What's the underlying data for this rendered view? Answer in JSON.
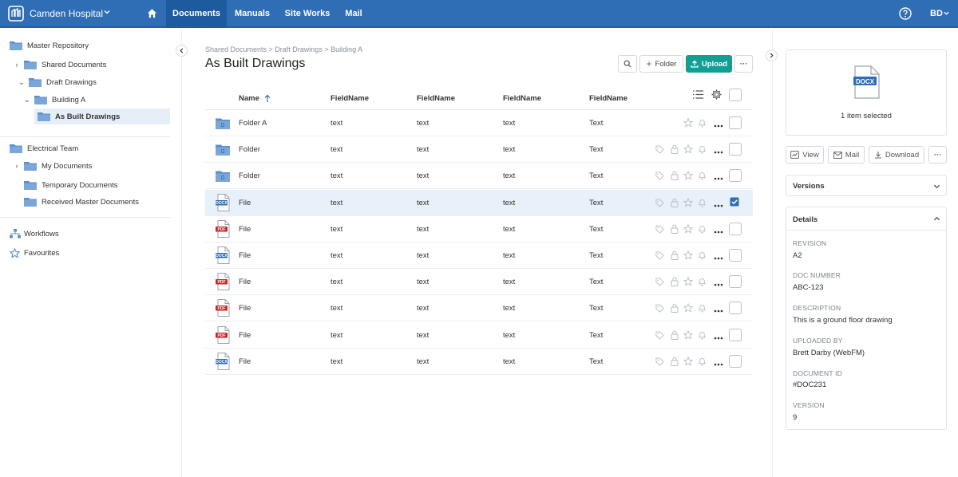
{
  "app": {
    "name": "Camden Hospital",
    "user_initials": "BD"
  },
  "nav": {
    "tabs": [
      {
        "label": "Documents"
      },
      {
        "label": "Manuals"
      },
      {
        "label": "Site Works"
      },
      {
        "label": "Mail"
      }
    ]
  },
  "tree": {
    "items": [
      {
        "label": "Master Repository"
      },
      {
        "label": "Shared Documents"
      },
      {
        "label": "Draft Drawings"
      },
      {
        "label": "Building A"
      },
      {
        "label": "As Built Drawings"
      },
      {
        "label": "Electrical Team"
      },
      {
        "label": "My Documents"
      },
      {
        "label": "Temporary Documents"
      },
      {
        "label": "Received Master Documents"
      }
    ],
    "workflows": "Workflows",
    "favourites": "Favourites"
  },
  "breadcrumb": "Shared Documents > Draft Drawings > Building A",
  "title": "As Built Drawings",
  "toolbar": {
    "folder": "Folder",
    "upload": "Upload",
    "more": "···"
  },
  "table": {
    "columns": [
      "Name",
      "FieldName",
      "FieldName",
      "FieldName",
      "FieldName"
    ],
    "rows": [
      {
        "type": "folder",
        "name": "Folder A",
        "c1": "text",
        "c2": "text",
        "c3": "text",
        "c4": "Text",
        "checked": false
      },
      {
        "type": "folder",
        "name": "Folder",
        "c1": "text",
        "c2": "text",
        "c3": "text",
        "c4": "Text",
        "checked": false
      },
      {
        "type": "folder",
        "name": "Folder",
        "c1": "text",
        "c2": "text",
        "c3": "text",
        "c4": "Text",
        "checked": false
      },
      {
        "type": "docx",
        "name": "File",
        "c1": "text",
        "c2": "text",
        "c3": "text",
        "c4": "Text",
        "checked": true
      },
      {
        "type": "pdf",
        "name": "File",
        "c1": "text",
        "c2": "text",
        "c3": "text",
        "c4": "Text",
        "checked": false
      },
      {
        "type": "docx",
        "name": "File",
        "c1": "text",
        "c2": "text",
        "c3": "text",
        "c4": "Text",
        "checked": false
      },
      {
        "type": "pdf",
        "name": "File",
        "c1": "text",
        "c2": "text",
        "c3": "text",
        "c4": "Text",
        "checked": false
      },
      {
        "type": "pdf",
        "name": "File",
        "c1": "text",
        "c2": "text",
        "c3": "text",
        "c4": "Text",
        "checked": false
      },
      {
        "type": "pdf",
        "name": "File",
        "c1": "text",
        "c2": "text",
        "c3": "text",
        "c4": "Text",
        "checked": false
      },
      {
        "type": "docx",
        "name": "File",
        "c1": "text",
        "c2": "text",
        "c3": "text",
        "c4": "Text",
        "checked": false
      }
    ],
    "file_badges": {
      "docx": "DOCX",
      "pdf": "PDF"
    }
  },
  "preview": {
    "badge": "DOCX",
    "selection_text": "1 item selected"
  },
  "actions": {
    "view": "View",
    "mail": "Mail",
    "download": "Download",
    "more": "···"
  },
  "versions": {
    "title": "Versions"
  },
  "details": {
    "title": "Details",
    "fields": [
      {
        "label": "REVISION",
        "value": "A2"
      },
      {
        "label": "DOC NUMBER",
        "value": "ABC-123"
      },
      {
        "label": "DESCRIPTION",
        "value": "This is a ground floor drawing"
      },
      {
        "label": "UPLOADED BY",
        "value": "Brett Darby (WebFM)"
      },
      {
        "label": "DOCUMENT ID",
        "value": "#DOC231"
      },
      {
        "label": "VERSION",
        "value": "9"
      }
    ]
  },
  "colors": {
    "brand": "#2f6db5",
    "accent": "#139e94",
    "folder": "#5b8fc9",
    "pdf": "#c62828",
    "docx": "#2f6db5"
  }
}
